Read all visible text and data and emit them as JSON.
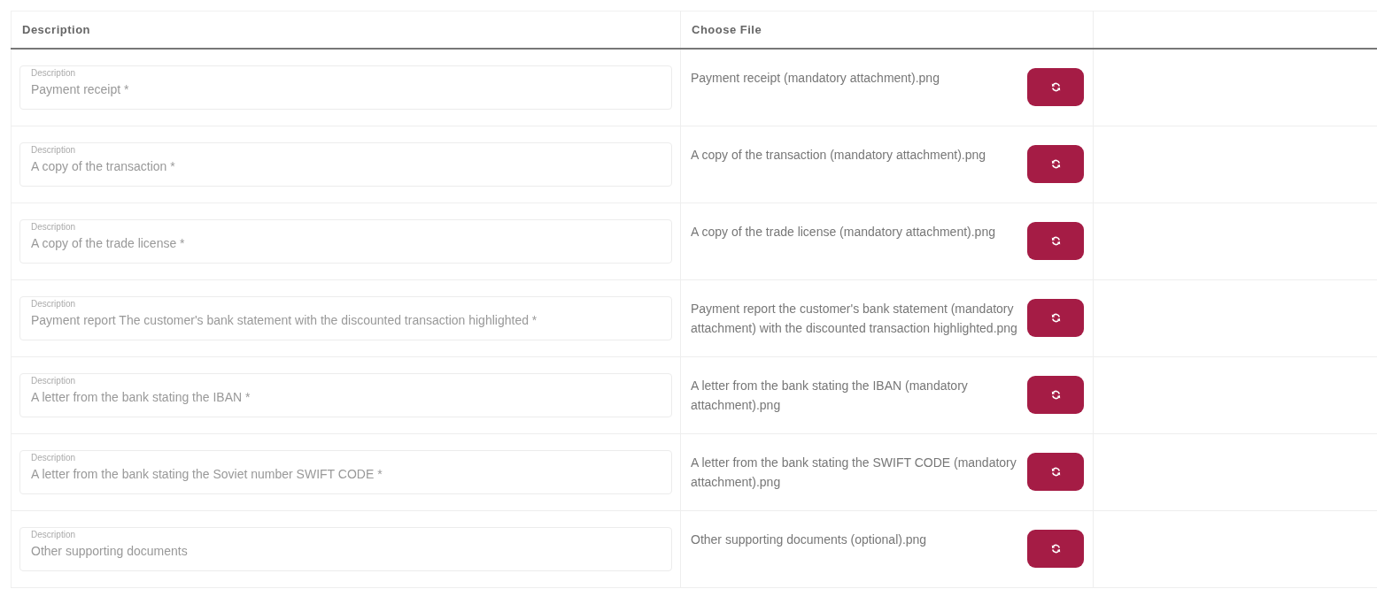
{
  "table": {
    "columns": [
      "Description",
      "Choose File"
    ],
    "rows": [
      {
        "field_label": "Description",
        "field_value": "Payment receipt *",
        "file_name": "Payment receipt (mandatory attachment).png"
      },
      {
        "field_label": "Description",
        "field_value": "A copy of the transaction *",
        "file_name": "A copy of the transaction (mandatory attachment).png"
      },
      {
        "field_label": "Description",
        "field_value": "A copy of the trade license *",
        "file_name": "A copy of the trade license (mandatory attachment).png"
      },
      {
        "field_label": "Description",
        "field_value": "Payment report The customer's bank statement with the discounted transaction highlighted *",
        "file_name": "Payment report the customer's bank statement (mandatory attachment) with the discounted transaction highlighted.png"
      },
      {
        "field_label": "Description",
        "field_value": "A letter from the bank stating the IBAN *",
        "file_name": "A letter from the bank stating the IBAN (mandatory attachment).png"
      },
      {
        "field_label": "Description",
        "field_value": "A letter from the bank stating the Soviet number SWIFT CODE *",
        "file_name": "A letter from the bank stating the SWIFT CODE (mandatory attachment).png"
      },
      {
        "field_label": "Description",
        "field_value": "Other supporting documents",
        "file_name": "Other supporting documents (optional).png"
      }
    ]
  }
}
